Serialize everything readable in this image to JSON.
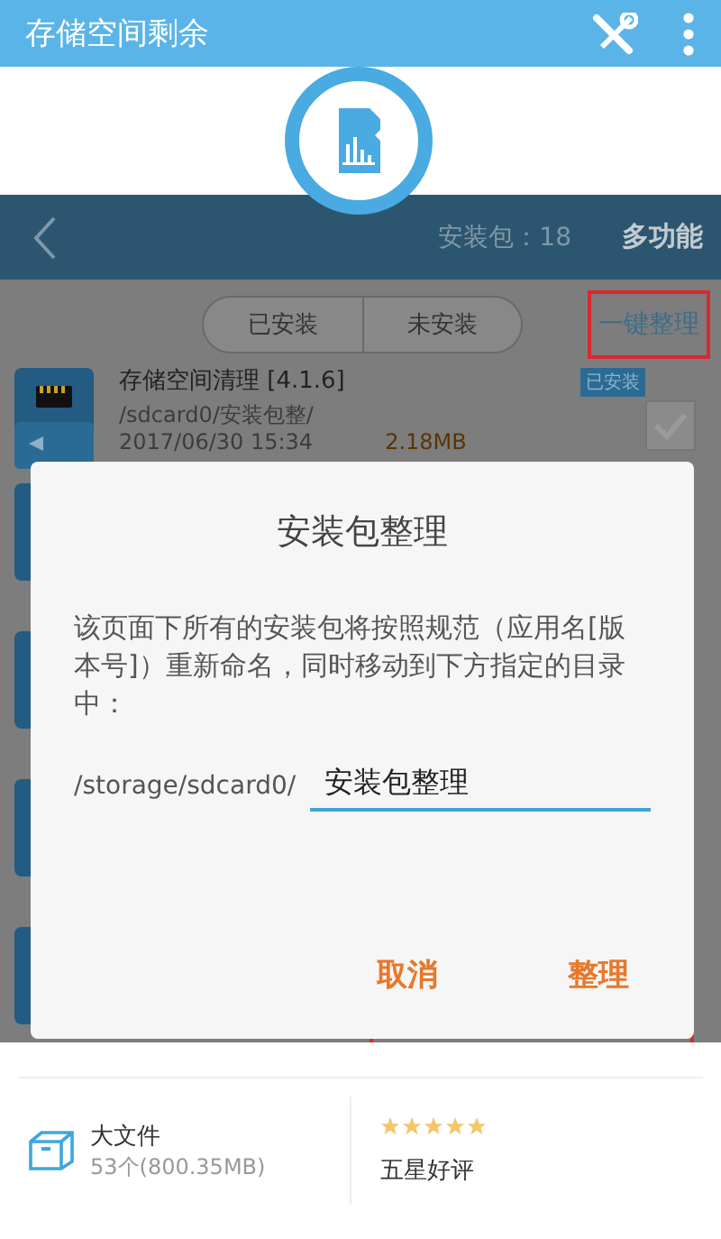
{
  "app_bar": {
    "title": "存储空间剩余"
  },
  "inner": {
    "header": {
      "count": "安装包：18",
      "menu": "多功能"
    },
    "tabs": [
      {
        "label": "已安装",
        "selected": false
      },
      {
        "label": "未安装",
        "selected": false
      }
    ],
    "organize": {
      "label": "一键整理",
      "highlighted": true
    },
    "packages": [
      {
        "name": "存储空间清理  [4.1.6]",
        "path": "/sdcard0/安装包整/",
        "date": "2017/06/30 15:34",
        "size": "2.18MB",
        "badge": "已安装",
        "checked": true
      }
    ]
  },
  "dialog": {
    "title": "安装包整理",
    "message": "该页面下所有的安装包将按照规范（应用名[版本号]）重新命名，同时移动到下方指定的目录中：",
    "path_prefix": "/storage/sdcard0/",
    "folder_value": "安装包整理",
    "buttons": [
      "取消",
      "整理"
    ]
  },
  "bottom": {
    "large_files": {
      "label": "大文件",
      "detail": "53个(800.35MB)"
    },
    "rating": {
      "stars": 5,
      "label": "五星好评"
    }
  }
}
